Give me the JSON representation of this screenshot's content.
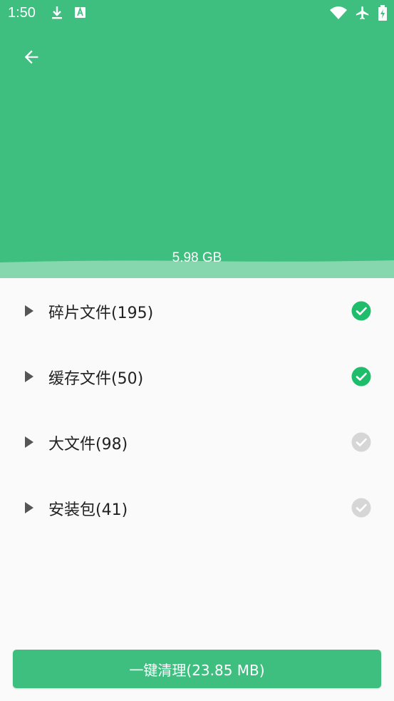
{
  "status_bar": {
    "time": "1:50",
    "icons": [
      "download-icon",
      "a-letter-icon",
      "wifi-icon",
      "airplane-icon",
      "battery-charging-icon"
    ]
  },
  "header": {
    "storage_used": "5.98 GB",
    "background_color": "#3fbf7f"
  },
  "items": [
    {
      "label": "碎片文件(195)",
      "checked": true
    },
    {
      "label": "缓存文件(50)",
      "checked": true
    },
    {
      "label": "大文件(98)",
      "checked": false
    },
    {
      "label": "安装包(41)",
      "checked": false
    }
  ],
  "colors": {
    "accent": "#3fbf7f",
    "check_on": "#1fbd6b",
    "check_off": "#d6d6d6"
  },
  "clean_button": {
    "label": "一键清理(23.85 MB)"
  }
}
